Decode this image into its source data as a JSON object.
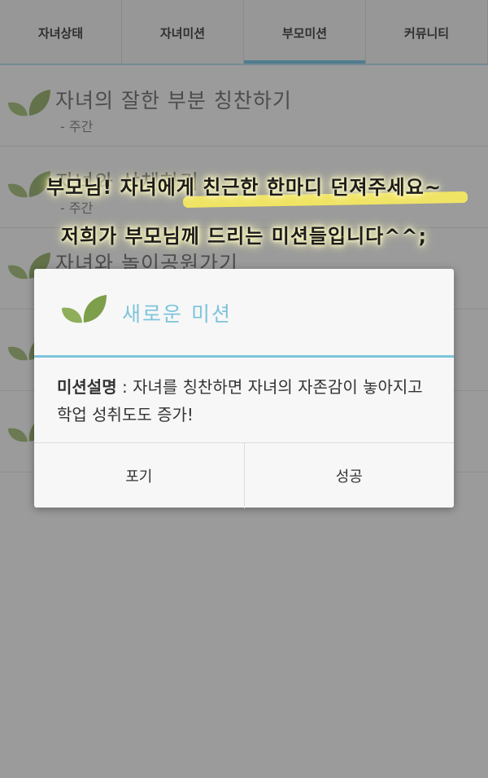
{
  "tabs": [
    {
      "label": "자녀상태"
    },
    {
      "label": "자녀미션"
    },
    {
      "label": "부모미션",
      "active": true
    },
    {
      "label": "커뮤니티"
    }
  ],
  "list": {
    "items": [
      {
        "title": "자녀의 잘한 부분 칭찬하기",
        "subtitle": "- 주간"
      },
      {
        "title": "자녀와 상체하기",
        "subtitle": "- 주간"
      },
      {
        "title": "자녀와 놀이공원가기",
        "subtitle": ""
      },
      {
        "title": "",
        "subtitle": ""
      },
      {
        "title": "",
        "subtitle": ""
      }
    ]
  },
  "banner": {
    "line1": "부모님! 자녀에게 친근한 한마디 던져주세요~",
    "line2": "저희가 부모님께 드리는 미션들입니다^^;"
  },
  "dialog": {
    "icon": "leaf-icon",
    "title": "새로운 미션",
    "desc_label": "미션설명",
    "desc_sep": " : ",
    "desc_text": "자녀를 칭찬하면 자녀의 자존감이 놓아지고 학업 성취도도 증가!",
    "btn_giveup": "포기",
    "btn_success": "성공"
  },
  "colors": {
    "accent": "#7ec4dc",
    "highlight": "#fff15a",
    "leaf": "#8fae5a"
  }
}
